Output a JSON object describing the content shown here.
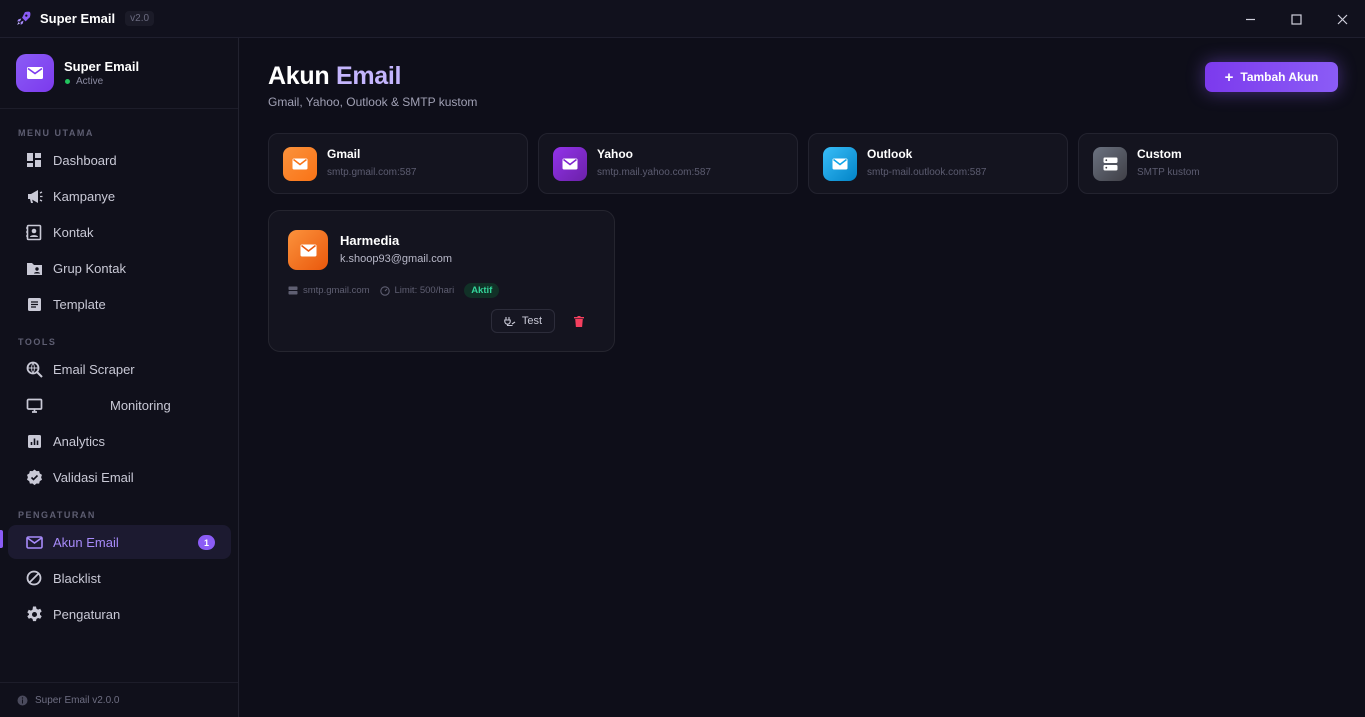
{
  "titlebar": {
    "title": "Super Email",
    "version": "v2.0"
  },
  "brand": {
    "name": "Super Email",
    "status": "Active"
  },
  "sidebar": {
    "sections": [
      {
        "title": "MENU UTAMA",
        "items": [
          {
            "label": "Dashboard",
            "icon": "dashboard-icon"
          },
          {
            "label": "Kampanye",
            "icon": "megaphone-icon"
          },
          {
            "label": "Kontak",
            "icon": "contact-icon"
          },
          {
            "label": "Grup Kontak",
            "icon": "folder-user-icon"
          },
          {
            "label": "Template",
            "icon": "template-icon"
          }
        ]
      },
      {
        "title": "TOOLS",
        "items": [
          {
            "label": "Email Scraper",
            "icon": "scraper-icon"
          },
          {
            "label": "Monitoring",
            "icon": "monitor-icon"
          },
          {
            "label": "Analytics",
            "icon": "analytics-icon"
          },
          {
            "label": "Validasi Email",
            "icon": "verified-badge-icon"
          }
        ]
      },
      {
        "title": "PENGATURAN",
        "items": [
          {
            "label": "Akun Email",
            "icon": "mail-icon",
            "badge": "1",
            "active": true
          },
          {
            "label": "Blacklist",
            "icon": "block-icon"
          },
          {
            "label": "Pengaturan",
            "icon": "gear-icon"
          }
        ]
      }
    ],
    "footer": "Super Email v2.0.0"
  },
  "main": {
    "title_part1": "Akun",
    "title_part2": "Email",
    "subtitle": "Gmail, Yahoo, Outlook & SMTP kustom",
    "add_button": "Tambah Akun",
    "providers": [
      {
        "name": "Gmail",
        "host": "smtp.gmail.com:587",
        "color": "#f97316"
      },
      {
        "name": "Yahoo",
        "host": "smtp.mail.yahoo.com:587",
        "color": "#7e22ce"
      },
      {
        "name": "Outlook",
        "host": "smtp-mail.outlook.com:587",
        "color": "#0ea5e9"
      },
      {
        "name": "Custom",
        "host": "SMTP kustom",
        "color": "#52525b"
      }
    ],
    "account": {
      "name": "Harmedia",
      "email": "k.shoop93@gmail.com",
      "host": "smtp.gmail.com",
      "limit": "Limit: 500/hari",
      "status": "Aktif",
      "test_label": "Test"
    }
  },
  "colors": {
    "accent": "#8b5cf6",
    "success": "#34d399",
    "danger": "#f43f5e"
  }
}
